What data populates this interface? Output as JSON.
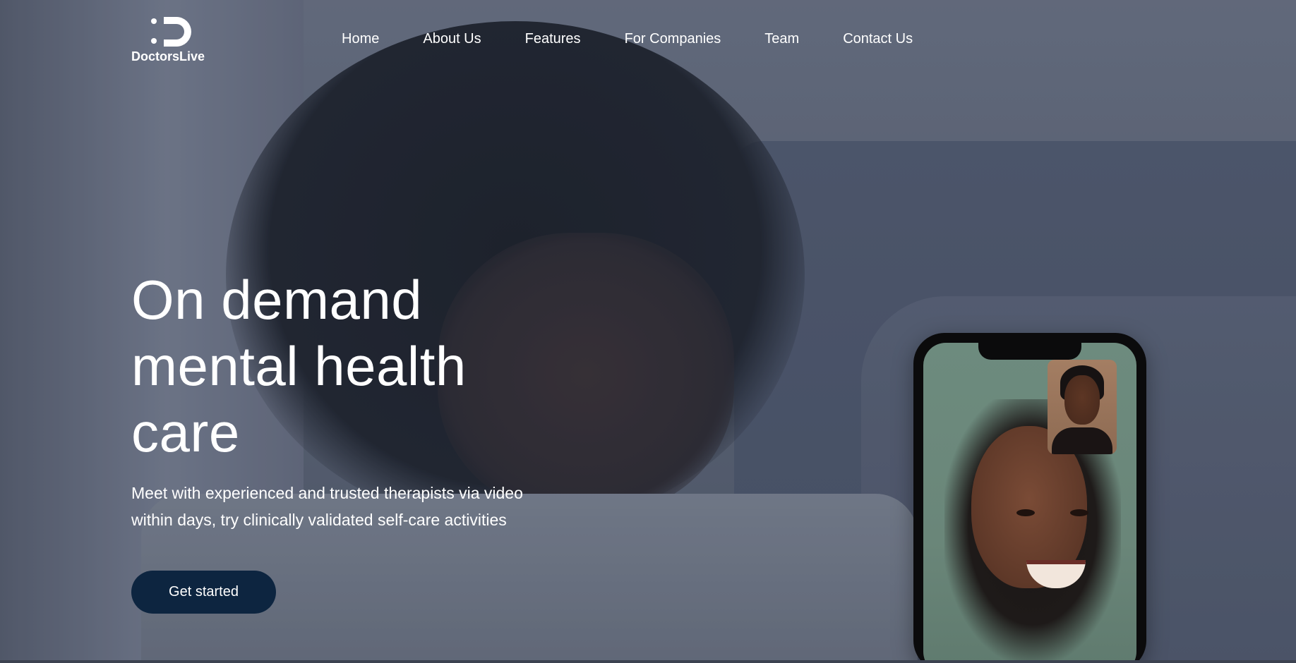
{
  "brand": {
    "logo_text": "DoctorsLive",
    "logo_icon": "d-circle-logo-icon"
  },
  "nav": {
    "items": [
      {
        "label": "Home"
      },
      {
        "label": "About Us"
      },
      {
        "label": "Features"
      },
      {
        "label": "For Companies"
      },
      {
        "label": "Team"
      },
      {
        "label": "Contact Us"
      }
    ]
  },
  "hero": {
    "title_line1": "On demand",
    "title_line2": "mental health",
    "title_line3": "care",
    "subtitle_line1": "Meet with experienced and trusted therapists via video",
    "subtitle_line2": "within days, try clinically validated self-care activities",
    "cta_label": "Get started"
  },
  "colors": {
    "cta_background": "#0d2540",
    "text": "#ffffff",
    "overlay": "#5f6677"
  }
}
